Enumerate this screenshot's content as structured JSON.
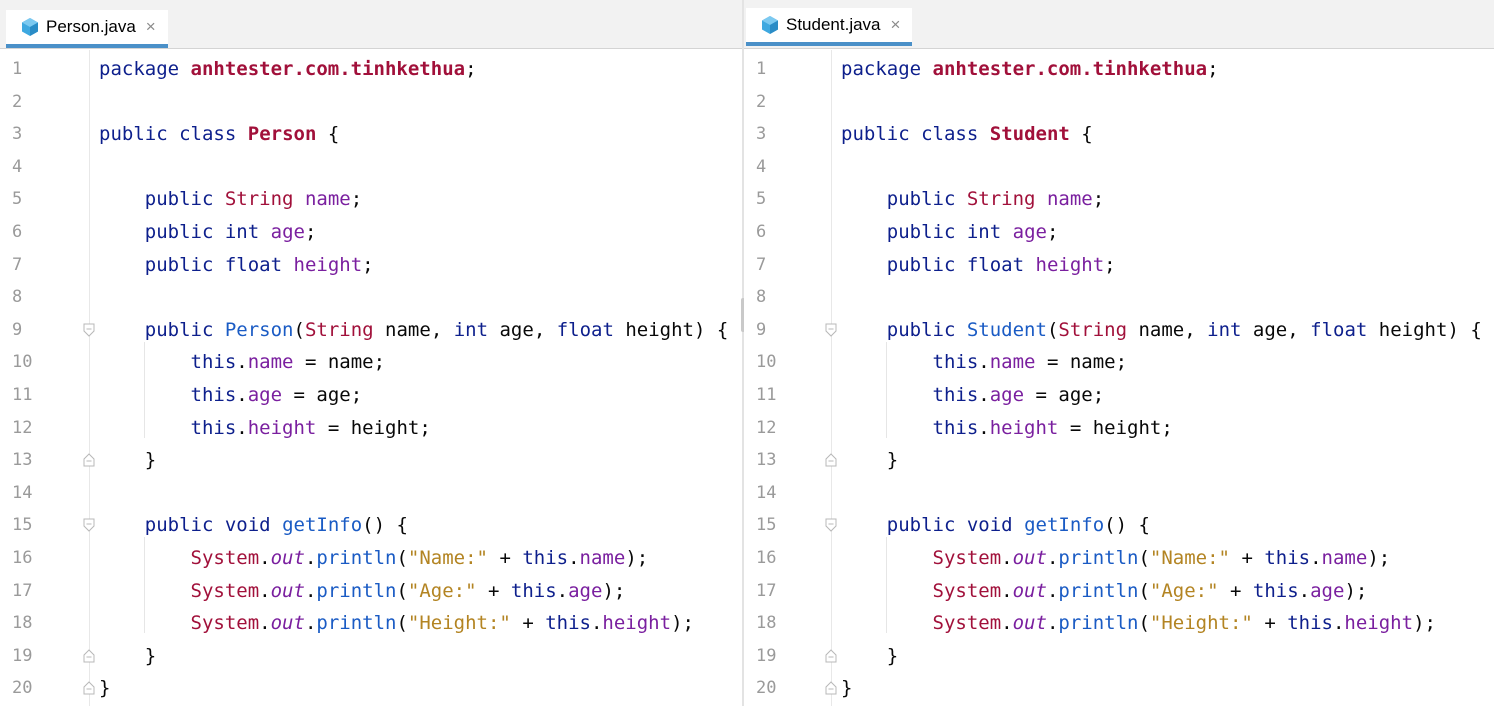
{
  "left": {
    "tab": {
      "label": "Person.java",
      "close": "×"
    },
    "class_name": "Person"
  },
  "right": {
    "tab": {
      "label": "Student.java",
      "close": "×"
    },
    "class_name": "Student"
  },
  "line_numbers": [
    "1",
    "2",
    "3",
    "4",
    "5",
    "6",
    "7",
    "8",
    "9",
    "10",
    "11",
    "12",
    "13",
    "14",
    "15",
    "16",
    "17",
    "18",
    "19",
    "20"
  ],
  "code": {
    "package_kw": "package",
    "package_name": "anhtester.com.tinhkethua",
    "public_kw": "public",
    "class_kw": "class",
    "string_type": "String",
    "int_kw": "int",
    "float_kw": "float",
    "void_kw": "void",
    "this_kw": "this",
    "field_name": "name",
    "field_age": "age",
    "field_height": "height",
    "param_name": "name",
    "param_age": "age",
    "param_height": "height",
    "method_getinfo": "getInfo",
    "system": "System",
    "out": "out",
    "println": "println",
    "str_name": "\"Name:\"",
    "str_age": "\"Age:\"",
    "str_height": "\"Height:\""
  }
}
